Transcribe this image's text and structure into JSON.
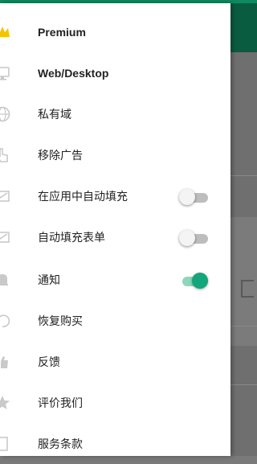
{
  "drawer": {
    "items": [
      {
        "label": "Premium",
        "icon": "crown-icon",
        "bold": true
      },
      {
        "label": "Web/Desktop",
        "icon": "desktop-icon",
        "bold": true
      },
      {
        "label": "私有域",
        "icon": "www-globe-icon"
      },
      {
        "label": "移除广告",
        "icon": "hand-touch-icon"
      },
      {
        "label": "在应用中自动填充",
        "icon": "autofill-icon",
        "toggle": false
      },
      {
        "label": "自动填充表单",
        "icon": "form-autofill-icon",
        "toggle": false
      },
      {
        "label": "通知",
        "icon": "bell-icon",
        "toggle": true
      },
      {
        "label": "恢复购买",
        "icon": "restore-icon"
      },
      {
        "label": "反馈",
        "icon": "thumbs-up-icon"
      },
      {
        "label": "评价我们",
        "icon": "star-icon"
      },
      {
        "label": "服务条款",
        "icon": "document-icon"
      }
    ]
  },
  "colors": {
    "accent": "#12a67a",
    "header_dark": "#0a5c40",
    "crown": "#f5c400"
  }
}
